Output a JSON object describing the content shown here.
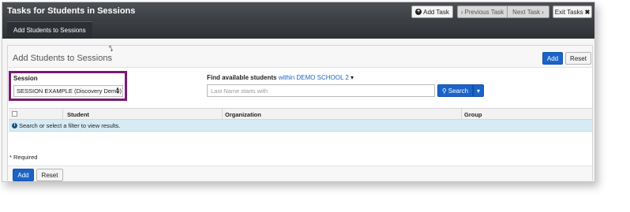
{
  "header": {
    "title": "Tasks for Students in Sessions",
    "add_task": "Add Task",
    "previous_task": "Previous Task",
    "next_task": "Next Task",
    "exit_tasks": "Exit Tasks"
  },
  "tabs": [
    {
      "label": "Add Students to Sessions"
    }
  ],
  "panel": {
    "title": "Add Students to Sessions",
    "add_label": "Add",
    "reset_label": "Reset"
  },
  "session": {
    "label": "Session",
    "selected": "SESSION EXAMPLE (Discovery Demo)"
  },
  "find": {
    "label": "Find available students",
    "scope": "within DEMO SCHOOL 2",
    "placeholder": "Last Name starts with",
    "search_label": "Search"
  },
  "table": {
    "columns": [
      "Student",
      "Organization",
      "Group"
    ],
    "message": "Search or select a filter to view results."
  },
  "required_note": "* Required",
  "footer": {
    "add_label": "Add",
    "reset_label": "Reset"
  },
  "colors": {
    "primary": "#1a63c8",
    "header": "#3a3d42",
    "highlight_border": "#7a1a72",
    "info_row": "#d7ebf5"
  }
}
